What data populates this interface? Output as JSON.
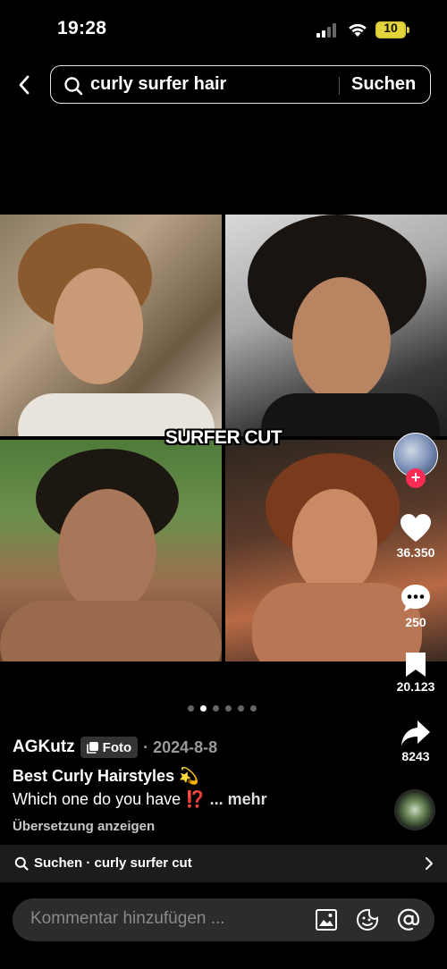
{
  "status": {
    "time": "19:28",
    "battery": "10"
  },
  "search": {
    "query": "curly surfer hair",
    "submit_label": "Suchen"
  },
  "post": {
    "caption_overlay": "SURFER CUT",
    "author": "AGKutz",
    "type_badge": "Foto",
    "date": "· 2024-8-8",
    "title": "Best Curly Hairstyles 💫",
    "body": "Which one do you have ⁉️",
    "more_label": "... mehr",
    "translate_label": "Übersetzung anzeigen",
    "carousel_count": 6,
    "carousel_active_index": 1
  },
  "actions": {
    "likes": "36.350",
    "comments": "250",
    "saves": "20.123",
    "shares": "8243"
  },
  "related_search": {
    "label": "Suchen · curly surfer cut"
  },
  "comment_bar": {
    "placeholder": "Kommentar hinzufügen ..."
  },
  "colors": {
    "accent": "#fe2c55",
    "battery": "#e3d53a",
    "background": "#000000"
  },
  "icons": {
    "back": "chevron-left-icon",
    "search": "search-icon",
    "like": "heart-icon",
    "comment": "comment-bubble-icon",
    "save": "bookmark-icon",
    "share": "share-arrow-icon",
    "image": "image-icon",
    "emoji": "emoji-icon",
    "mention": "at-sign-icon"
  }
}
